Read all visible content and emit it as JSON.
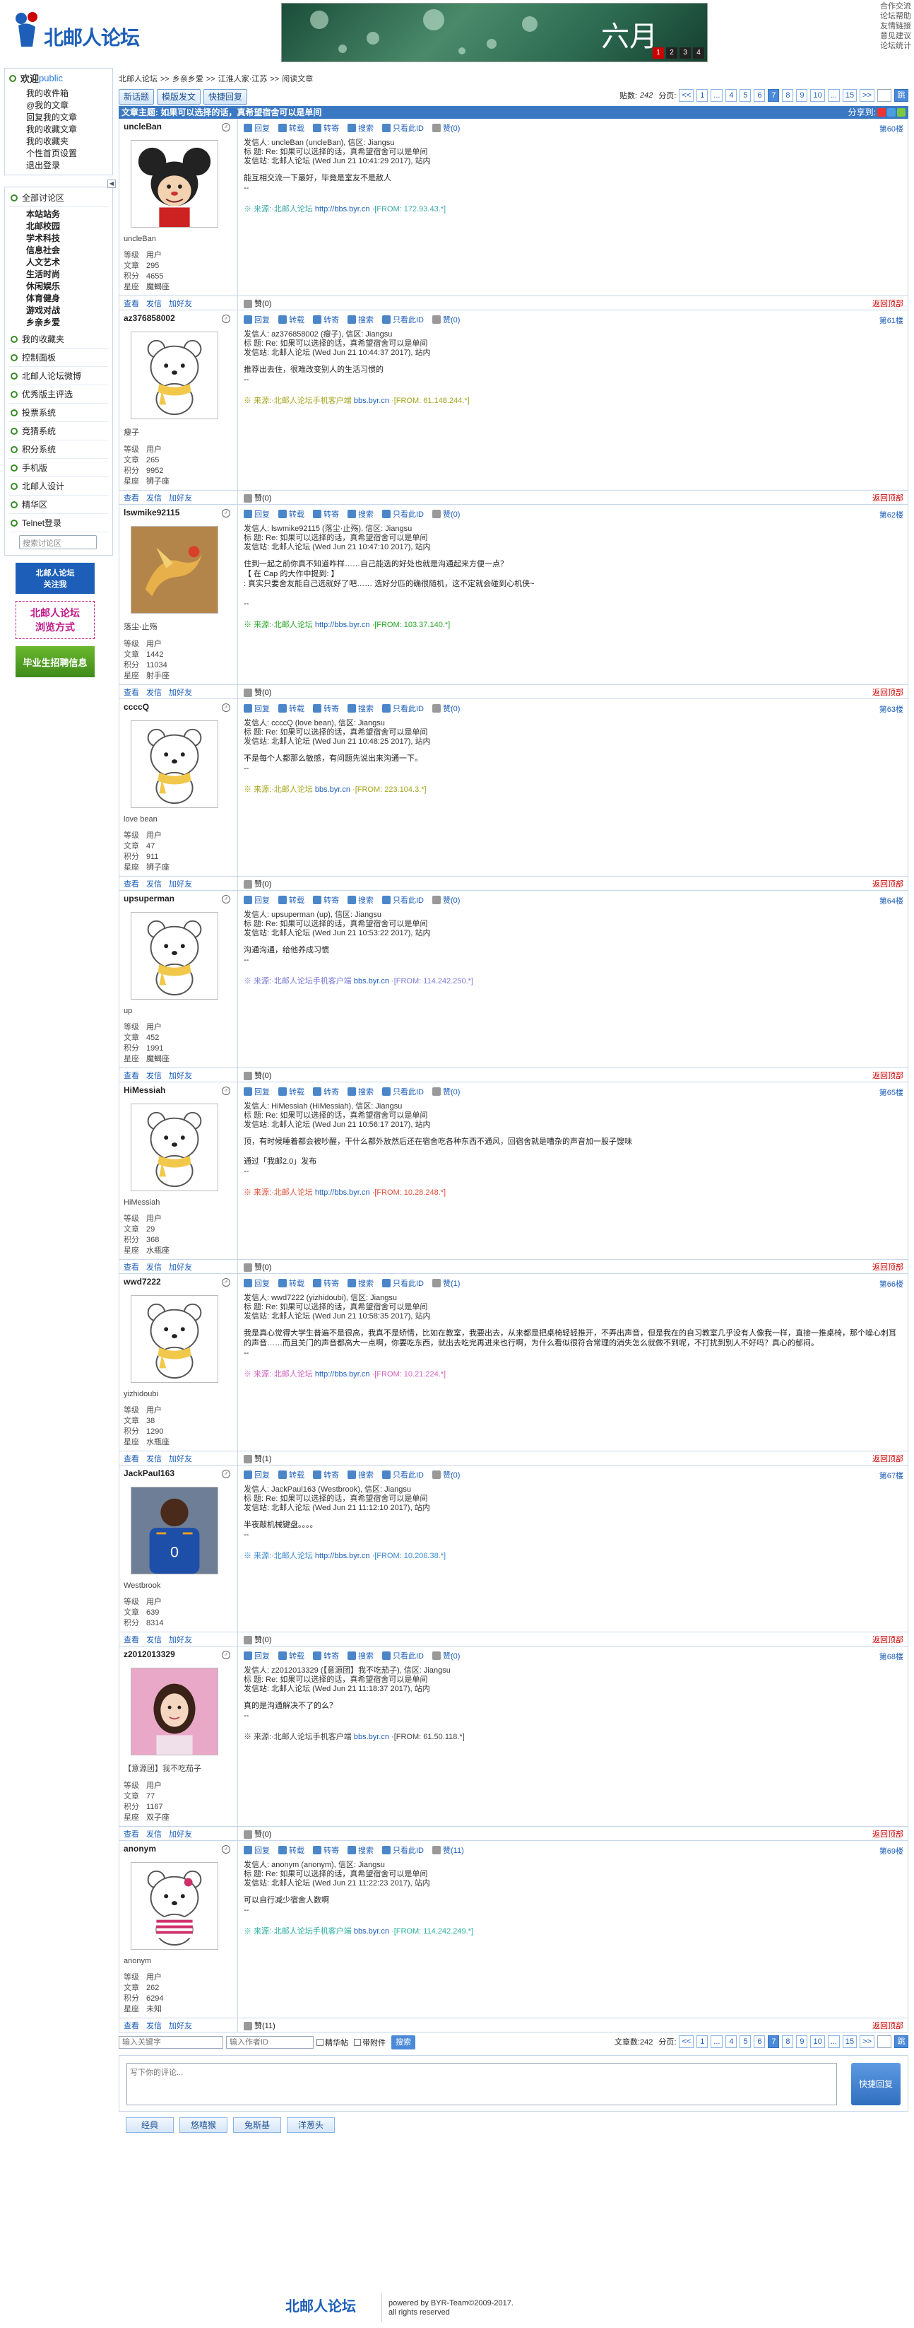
{
  "site": {
    "logo_text": "北邮人论坛",
    "banner_text": "六月",
    "banner_pages": [
      "1",
      "2",
      "3",
      "4"
    ],
    "top_links": [
      "合作交流",
      "论坛帮助",
      "友情链接",
      "意见建议",
      "论坛统计"
    ]
  },
  "left": {
    "welcome": "欢迎",
    "uid": "public",
    "mail_items": [
      "我的收件箱",
      "@我的文章",
      "回复我的文章",
      "我的收藏文章",
      "我的收藏夹",
      "个性首页设置",
      "退出登录"
    ],
    "all_boards": "全部讨论区",
    "boards": [
      "本站站务",
      "北邮校园",
      "学术科技",
      "信息社会",
      "人文艺术",
      "生活时尚",
      "休闲娱乐",
      "体育健身",
      "游戏对战",
      "乡亲乡爱"
    ],
    "sections": [
      "我的收藏夹",
      "控制面板",
      "北邮人论坛微博",
      "优秀版主评选",
      "投票系统",
      "竞猜系统",
      "积分系统",
      "手机版",
      "北邮人设计",
      "精华区",
      "Telnet登录"
    ],
    "search_placeholder": "搜索讨论区",
    "ads": [
      "北邮人论坛\n关注我",
      "北邮人论坛\n浏览方式",
      "毕业生招聘信息"
    ]
  },
  "crumb": [
    "北邮人论坛",
    ">>",
    "乡亲乡爱",
    ">>",
    "江淮人家·江苏",
    ">>",
    "阅读文章"
  ],
  "action_buttons": [
    "新话题",
    "模版发文",
    "快捷回复"
  ],
  "pager": {
    "count_label": "贴数:",
    "count": "242",
    "page_label": "分页:",
    "pages": [
      "<<",
      "1",
      "...",
      "4",
      "5",
      "6",
      "7",
      "8",
      "9",
      "10",
      "...",
      "15",
      ">>"
    ],
    "current": "7",
    "go": "跳"
  },
  "thread_title": "文章主题: 如果可以选择的话，真希望宿舍可以是单间",
  "share_label": "分享到:",
  "tools": [
    "回复",
    "转载",
    "转寄",
    "搜索",
    "只看此ID"
  ],
  "foot_links": [
    "查看",
    "发信",
    "加好友"
  ],
  "to_top": "返回顶部",
  "labels": {
    "level": "等级",
    "posts": "文章",
    "score": "积分",
    "star": "星座"
  },
  "posts": [
    {
      "id": "uncleBan",
      "nick": "uncleBan",
      "level": "用户",
      "posts": "295",
      "score": "4655",
      "star": "魔蝎座",
      "floor": "第60楼",
      "like": "赞(0)",
      "h1": "发信人: uncleBan (uncleBan), 信区: Jiangsu",
      "h2": "标  题: Re: 如果可以选择的话，真希望宿舍可以是单间",
      "h3": "发信站: 北邮人论坛 (Wed Jun 21 10:41:29 2017), 站内",
      "content": "能互相交流一下最好，毕竟是室友不是敌人\n--",
      "src_prefix": "※ 来源:·北邮人论坛",
      "src_link": "http://bbs.byr.cn",
      "src_from": "·[FROM: 172.93.43.*]",
      "src_color": "#3aa6a6",
      "avatar": "mouse"
    },
    {
      "id": "az376858002",
      "nick": "瘦子",
      "level": "用户",
      "posts": "265",
      "score": "9952",
      "star": "狮子座",
      "floor": "第61楼",
      "like": "赞(0)",
      "h1": "发信人: az376858002 (瘦子), 信区: Jiangsu",
      "h2": "标  题: Re: 如果可以选择的话，真希望宿舍可以是单间",
      "h3": "发信站: 北邮人论坛 (Wed Jun 21 10:44:37 2017), 站内",
      "content": "推荐出去住，很难改变别人的生活习惯的\n--",
      "src_prefix": "※ 来源:·北邮人论坛手机客户端",
      "src_link": "bbs.byr.cn",
      "src_from": "·[FROM: 61.148.244.*]",
      "src_color": "#a6a620",
      "avatar": "bear"
    },
    {
      "id": "lswmike92115",
      "nick": "落尘·止殇",
      "level": "用户",
      "posts": "1442",
      "score": "11034",
      "star": "射手座",
      "floor": "第62楼",
      "like": "赞(0)",
      "h1": "发信人: lswmike92115 (落尘·止殇), 信区: Jiangsu",
      "h2": "标  题: Re: 如果可以选择的话，真希望宿舍可以是单间",
      "h3": "发信站: 北邮人论坛 (Wed Jun 21 10:47:10 2017), 站内",
      "content": "住到一起之前你真不知道咋样……自己能选的好处也就是沟通起来方便一点？\n【 在 Cap 的大作中提到: 】\n: 真实只要舍友能自己选就好了吧…… 选好分匹的确很随机，这不定就会碰到心机侠~\n\n--",
      "src_prefix": "※ 来源:·北邮人论坛",
      "src_link": "http://bbs.byr.cn",
      "src_from": "·[FROM: 103.37.140.*]",
      "src_color": "#2aa62a",
      "avatar": "dragon"
    },
    {
      "id": "ccccQ",
      "nick": "love bean",
      "level": "用户",
      "posts": "47",
      "score": "911",
      "star": "狮子座",
      "floor": "第63楼",
      "like": "赞(0)",
      "h1": "发信人: ccccQ (love bean), 信区: Jiangsu",
      "h2": "标  题: Re: 如果可以选择的话，真希望宿舍可以是单间",
      "h3": "发信站: 北邮人论坛 (Wed Jun 21 10:48:25 2017), 站内",
      "content": "不是每个人都那么敏感，有问题先说出来沟通一下。\n--",
      "src_prefix": "※ 来源:·北邮人论坛",
      "src_link": "bbs.byr.cn",
      "src_from": "·[FROM: 223.104.3.*]",
      "src_color": "#a6a620",
      "avatar": "bear"
    },
    {
      "id": "upsuperman",
      "nick": "up",
      "level": "用户",
      "posts": "452",
      "score": "1991",
      "star": "魔蝎座",
      "floor": "第64楼",
      "like": "赞(0)",
      "h1": "发信人: upsuperman (up), 信区: Jiangsu",
      "h2": "标  题: Re: 如果可以选择的话，真希望宿舍可以是单间",
      "h3": "发信站: 北邮人论坛 (Wed Jun 21 10:53:22 2017), 站内",
      "content": "沟通沟通，给他养成习惯\n--",
      "src_prefix": "※ 来源:·北邮人论坛手机客户端",
      "src_link": "bbs.byr.cn",
      "src_from": "·[FROM: 114.242.250.*]",
      "src_color": "#7a7ad6",
      "avatar": "bear"
    },
    {
      "id": "HiMessiah",
      "nick": "HiMessiah",
      "level": "用户",
      "posts": "29",
      "score": "368",
      "star": "水瓶座",
      "floor": "第65楼",
      "like": "赞(0)",
      "h1": "发信人: HiMessiah (HiMessiah), 信区: Jiangsu",
      "h2": "标  题: Re: 如果可以选择的话，真希望宿舍可以是单间",
      "h3": "发信站: 北邮人论坛 (Wed Jun 21 10:56:17 2017), 站内",
      "content": "顶，有时候睡着都会被吵醒，干什么都外放然后还在宿舍吃各种东西不通风，回宿舍就是嘈杂的声音加一股子馊味\n\n通过「我邮2.0」发布\n--",
      "src_prefix": "※ 来源:·北邮人论坛",
      "src_link": "http://bbs.byr.cn",
      "src_from": "·[FROM: 10.28.248.*]",
      "src_color": "#e0503a",
      "avatar": "bear"
    },
    {
      "id": "wwd7222",
      "nick": "yizhidoubi",
      "level": "用户",
      "posts": "38",
      "score": "1290",
      "star": "水瓶座",
      "floor": "第66楼",
      "like": "赞(1)",
      "h1": "发信人: wwd7222 (yizhidoubi), 信区: Jiangsu",
      "h2": "标  题: Re: 如果可以选择的话，真希望宿舍可以是单间",
      "h3": "发信站: 北邮人论坛 (Wed Jun 21 10:58:35 2017), 站内",
      "content": "我是真心觉得大学生普遍不是很高，我真不是矫情，比如在教室，我要出去，从来都是把桌椅轻轻推开，不弄出声音，但是我在的自习教室几乎没有人像我一样，直接一推桌椅，那个噪心刺耳的声音……而且关门的声音都高大一点啊，你要吃东西，就出去吃完再进来也行啊，为什么看似很符合常理的消失怎么就做不到呢，不打扰到别人不好吗？真心的郁闷。\n--",
      "src_prefix": "※ 来源:·北邮人论坛",
      "src_link": "http://bbs.byr.cn",
      "src_from": "·[FROM: 10.21.224.*]",
      "src_color": "#d060c0",
      "avatar": "bear"
    },
    {
      "id": "JackPaul163",
      "nick": "Westbrook",
      "level": "用户",
      "posts": "639",
      "score": "8314",
      "star": "",
      "floor": "第67楼",
      "like": "赞(0)",
      "h1": "发信人: JackPaul163 (Westbrook), 信区: Jiangsu",
      "h2": "标  题: Re: 如果可以选择的话，真希望宿舍可以是单间",
      "h3": "发信站: 北邮人论坛 (Wed Jun 21 11:12:10 2017), 站内",
      "content": "半夜敲机械键盘。。。。\n--",
      "src_prefix": "※ 来源:·北邮人论坛",
      "src_link": "http://bbs.byr.cn",
      "src_from": "·[FROM: 10.206.38.*]",
      "src_color": "#3a8ad6",
      "avatar": "player"
    },
    {
      "id": "z2012013329",
      "nick": "【意源团】我不吃茄子",
      "level": "用户",
      "posts": "77",
      "score": "1167",
      "star": "双子座",
      "floor": "第68楼",
      "like": "赞(0)",
      "h1": "发信人: z2012013329 (【意源团】我不吃茄子), 信区: Jiangsu",
      "h2": "标  题: Re: 如果可以选择的话，真希望宿舍可以是单间",
      "h3": "发信站: 北邮人论坛 (Wed Jun 21 11:18:37 2017), 站内",
      "content": "真的是沟通解决不了的么？\n--",
      "src_prefix": "※ 来源:·北邮人论坛手机客户端",
      "src_link": "bbs.byr.cn",
      "src_from": "·[FROM: 61.50.118.*]",
      "src_color": "#444444",
      "avatar": "girl"
    },
    {
      "id": "anonym",
      "nick": "anonym",
      "level": "用户",
      "posts": "262",
      "score": "6294",
      "star": "未知",
      "floor": "第69楼",
      "like": "赞(11)",
      "h1": "发信人: anonym (anonym), 信区: Jiangsu",
      "h2": "标  题: Re: 如果可以选择的话，真希望宿舍可以是单间",
      "h3": "发信站: 北邮人论坛 (Wed Jun 21 11:22:23 2017), 站内",
      "content": "可以自行减少宿舍人数啊\n--",
      "src_prefix": "※ 来源:·北邮人论坛手机客户端",
      "src_link": "bbs.byr.cn",
      "src_from": "·[FROM: 114.242.249.*]",
      "src_color": "#2ab0a0",
      "avatar": "bearpink"
    }
  ],
  "bottom": {
    "kw_placeholder": "输入关键字",
    "author_placeholder": "输入作者ID",
    "chk1": "精华帖",
    "chk2": "带附件",
    "search": "搜索",
    "count_label": "文章数:242",
    "page_label": "分页:"
  },
  "reply": {
    "placeholder": "写下你的评论...",
    "button": "快捷回复"
  },
  "emoji_tabs": [
    "经典",
    "悠嘻猴",
    "兔斯基",
    "洋葱头"
  ],
  "footer": {
    "logo": "北邮人论坛",
    "line1": "powered by BYR-Team©2009-2017.",
    "line2": "all rights reserved"
  }
}
